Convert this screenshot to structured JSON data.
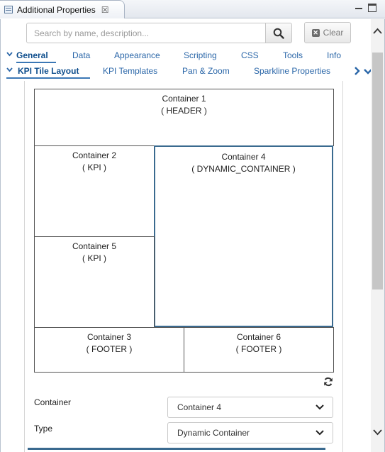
{
  "view": {
    "title": "Additional Properties",
    "close_symbol": "☒"
  },
  "search": {
    "placeholder": "Search by name, description...",
    "value": "",
    "clear_label": "Clear"
  },
  "tabs_row1": [
    {
      "label": "General",
      "active": true
    },
    {
      "label": "Data",
      "active": false
    },
    {
      "label": "Appearance",
      "active": false
    },
    {
      "label": "Scripting",
      "active": false
    },
    {
      "label": "CSS",
      "active": false
    },
    {
      "label": "Tools",
      "active": false
    },
    {
      "label": "Info",
      "active": false
    }
  ],
  "tabs_row2": [
    {
      "label": "KPI Tile Layout",
      "active": true
    },
    {
      "label": "KPI Templates",
      "active": false
    },
    {
      "label": "Pan & Zoom",
      "active": false
    },
    {
      "label": "Sparkline Properties",
      "active": false
    }
  ],
  "layout": {
    "containers": [
      {
        "name": "Container 1",
        "type": "( HEADER )",
        "selected": false
      },
      {
        "name": "Container 2",
        "type": "( KPI )",
        "selected": false
      },
      {
        "name": "Container 4",
        "type": "( DYNAMIC_CONTAINER )",
        "selected": true
      },
      {
        "name": "Container 5",
        "type": "( KPI )",
        "selected": false
      },
      {
        "name": "Container 3",
        "type": "( FOOTER )",
        "selected": false
      },
      {
        "name": "Container 6",
        "type": "( FOOTER )",
        "selected": false
      }
    ]
  },
  "form": {
    "container_label": "Container",
    "container_value": "Container 4",
    "type_label": "Type",
    "type_value": "Dynamic Container"
  },
  "colors": {
    "tab_link": "#2a66a8",
    "selected_border": "#3a6a8f"
  }
}
